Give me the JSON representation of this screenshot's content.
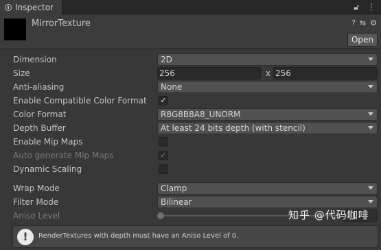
{
  "tab": {
    "title": "Inspector",
    "icons": [
      "lock-icon",
      "menu-icon"
    ]
  },
  "asset": {
    "name": "MirrorTexture",
    "open_label": "Open"
  },
  "props": {
    "dimension": {
      "label": "Dimension",
      "value": "2D"
    },
    "size": {
      "label": "Size",
      "width": "256",
      "x": "x",
      "height": "256"
    },
    "anti_aliasing": {
      "label": "Anti-aliasing",
      "value": "None"
    },
    "enable_compat": {
      "label": "Enable Compatible Color Format",
      "checked": true
    },
    "color_format": {
      "label": "Color Format",
      "value": "R8G8B8A8_UNORM"
    },
    "depth_buffer": {
      "label": "Depth Buffer",
      "value": "At least 24 bits depth (with stencil)"
    },
    "enable_mip": {
      "label": "Enable Mip Maps",
      "checked": false
    },
    "auto_mip": {
      "label": "Auto generate Mip Maps",
      "checked": true,
      "disabled": true
    },
    "dynamic_scaling": {
      "label": "Dynamic Scaling",
      "checked": false
    },
    "wrap_mode": {
      "label": "Wrap Mode",
      "value": "Clamp"
    },
    "filter_mode": {
      "label": "Filter Mode",
      "value": "Bilinear"
    },
    "aniso_level": {
      "label": "Aniso Level",
      "value": "0",
      "slider_min": 0,
      "slider_max": 16
    }
  },
  "help": {
    "text": "RenderTextures with depth must have an Aniso Level of 0."
  },
  "watermark": {
    "text": "知乎 @代码咖啡"
  }
}
